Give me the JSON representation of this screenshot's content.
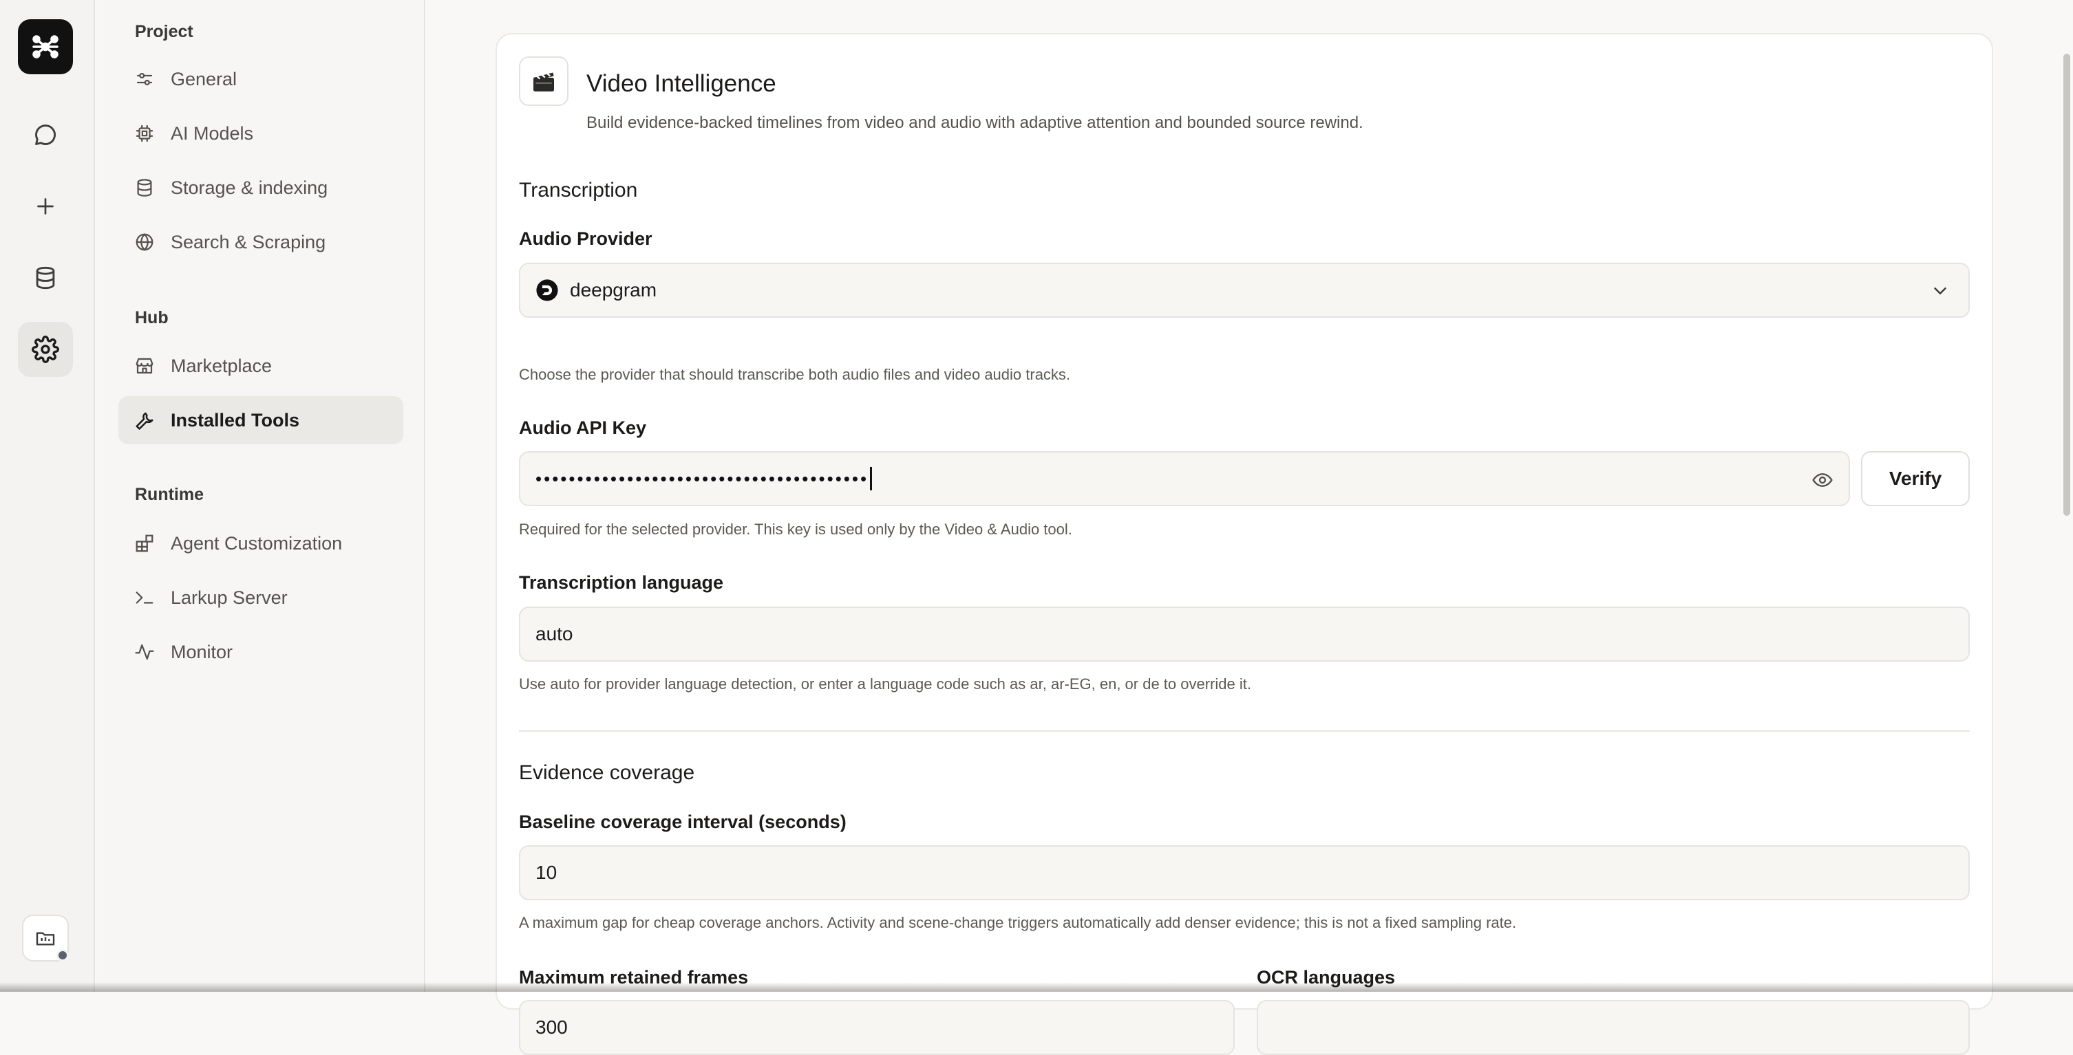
{
  "rail": {
    "logo": "app-logo-icon",
    "items": [
      "chat-icon",
      "plus-icon",
      "database-icon",
      "settings-icon"
    ],
    "bottom": "folder-icon"
  },
  "sidebar": {
    "sections": [
      {
        "label": "Project",
        "items": [
          {
            "label": "General",
            "icon": "sliders-icon"
          },
          {
            "label": "AI Models",
            "icon": "cpu-icon"
          },
          {
            "label": "Storage & indexing",
            "icon": "database-icon"
          },
          {
            "label": "Search & Scraping",
            "icon": "globe-icon"
          }
        ]
      },
      {
        "label": "Hub",
        "items": [
          {
            "label": "Marketplace",
            "icon": "store-icon"
          },
          {
            "label": "Installed Tools",
            "icon": "wrench-icon",
            "active": true
          }
        ]
      },
      {
        "label": "Runtime",
        "items": [
          {
            "label": "Agent Customization",
            "icon": "blocks-icon"
          },
          {
            "label": "Larkup Server",
            "icon": "terminal-icon"
          },
          {
            "label": "Monitor",
            "icon": "activity-icon"
          }
        ]
      }
    ]
  },
  "card": {
    "icon": "clapperboard-icon",
    "title": "Video Intelligence",
    "description": "Build evidence-backed timelines from video and audio with adaptive attention and bounded source rewind.",
    "transcription": {
      "heading": "Transcription",
      "audio_provider": {
        "label": "Audio Provider",
        "value": "deepgram",
        "help": "Choose the provider that should transcribe both audio files and video audio tracks."
      },
      "audio_api_key": {
        "label": "Audio API Key",
        "value": "••••••••••••••••••••••••••••••••••••••••",
        "verify_label": "Verify",
        "help": "Required for the selected provider. This key is used only by the Video & Audio tool."
      },
      "language": {
        "label": "Transcription language",
        "value": "auto",
        "help": "Use auto for provider language detection, or enter a language code such as ar, ar-EG, en, or de to override it."
      }
    },
    "evidence": {
      "heading": "Evidence coverage",
      "baseline": {
        "label": "Baseline coverage interval (seconds)",
        "value": "10",
        "help": "A maximum gap for cheap coverage anchors. Activity and scene-change triggers automatically add denser evidence; this is not a fixed sampling rate."
      },
      "max_frames": {
        "label": "Maximum retained frames",
        "value": "300"
      },
      "ocr": {
        "label": "OCR languages",
        "value": ""
      }
    }
  }
}
